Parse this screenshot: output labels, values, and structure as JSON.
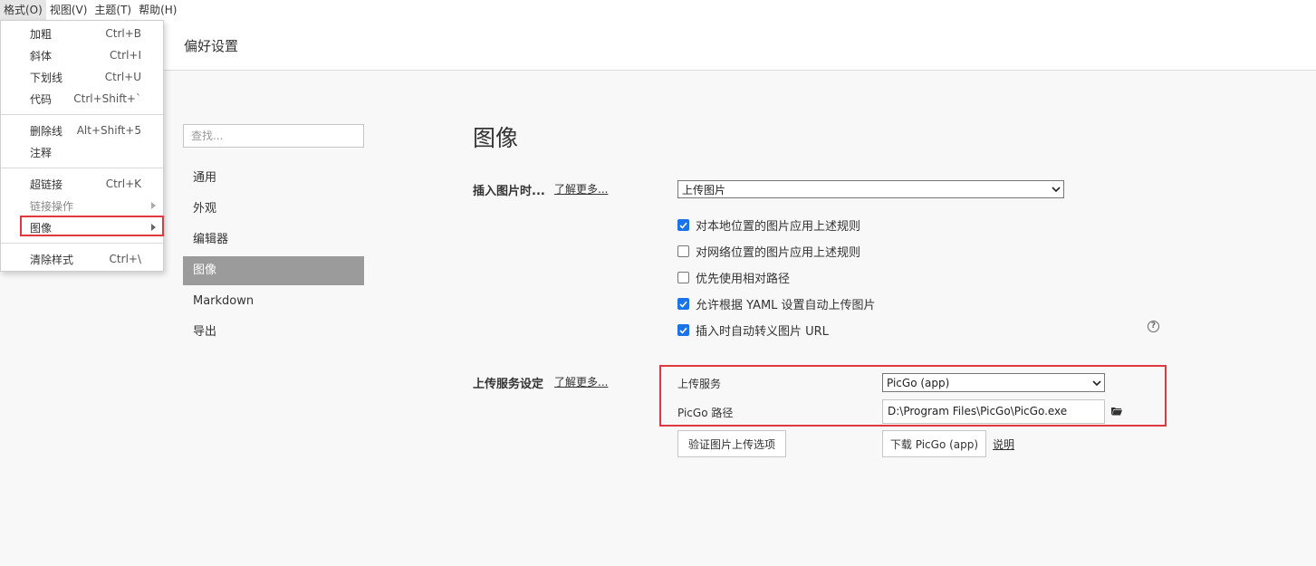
{
  "menubar": {
    "format": "格式(O)",
    "view": "视图(V)",
    "theme": "主题(T)",
    "help": "帮助(H)"
  },
  "header": {
    "title": "偏好设置"
  },
  "sidebar": {
    "search_placeholder": "查找...",
    "items": [
      {
        "label": "通用"
      },
      {
        "label": "外观"
      },
      {
        "label": "编辑器"
      },
      {
        "label": "图像",
        "selected": true
      },
      {
        "label": "Markdown"
      },
      {
        "label": "导出"
      }
    ]
  },
  "main": {
    "title": "图像",
    "insert": {
      "label": "插入图片时...",
      "learn_more": "了解更多...",
      "select_value": "上传图片",
      "checkboxes": [
        {
          "label": "对本地位置的图片应用上述规则",
          "checked": true
        },
        {
          "label": "对网络位置的图片应用上述规则",
          "checked": false
        },
        {
          "label": "优先使用相对路径",
          "checked": false
        },
        {
          "label": "允许根据 YAML 设置自动上传图片",
          "checked": true
        },
        {
          "label": "插入时自动转义图片 URL",
          "checked": true
        }
      ],
      "help_glyph": "?"
    },
    "upload": {
      "label": "上传服务设定",
      "learn_more": "了解更多...",
      "service_label": "上传服务",
      "service_value": "PicGo (app)",
      "path_label": "PicGo 路径",
      "path_value": "D:\\Program Files\\PicGo\\PicGo.exe",
      "verify_button": "验证图片上传选项",
      "download_button": "下载 PicGo (app)",
      "explain_link": "说明"
    }
  },
  "dropdown": {
    "items": [
      {
        "label": "加粗",
        "shortcut": "Ctrl+B"
      },
      {
        "label": "斜体",
        "shortcut": "Ctrl+I"
      },
      {
        "label": "下划线",
        "shortcut": "Ctrl+U"
      },
      {
        "label": "代码",
        "shortcut": "Ctrl+Shift+`"
      },
      {
        "label": "删除线",
        "shortcut": "Alt+Shift+5"
      },
      {
        "label": "注释",
        "shortcut": ""
      },
      {
        "label": "超链接",
        "shortcut": "Ctrl+K"
      },
      {
        "label": "链接操作",
        "shortcut": ""
      },
      {
        "label": "图像",
        "shortcut": ""
      },
      {
        "label": "清除样式",
        "shortcut": "Ctrl+\\"
      }
    ]
  },
  "colors": {
    "accent": "#1a73e8",
    "highlight": "#e0383e",
    "sidebar_selected": "#9b9b9b"
  },
  "icons": {
    "folder": "folder-icon",
    "help": "help-circle-icon",
    "chevron": "chevron-down-icon",
    "submenu": "submenu-arrow-icon",
    "check": "check-icon"
  }
}
